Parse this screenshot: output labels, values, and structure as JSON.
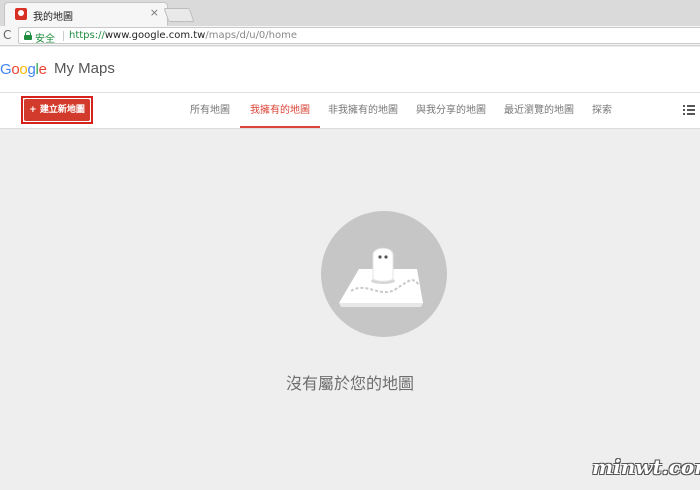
{
  "browser": {
    "tab_title": "我的地圖",
    "tab_close": "×",
    "reload_glyph": "C",
    "secure_label": "安全",
    "url_scheme": "https://",
    "url_host": "www.google.com.tw",
    "url_path": "/maps/d/u/0/home"
  },
  "header": {
    "logo_letters": [
      "G",
      "o",
      "o",
      "g",
      "l",
      "e"
    ],
    "logo_colors": [
      "#4285f4",
      "#ea4335",
      "#fbbc05",
      "#4285f4",
      "#34a853",
      "#ea4335"
    ],
    "product_name": "My Maps"
  },
  "toolbar": {
    "create_label": "+ 建立新地圖",
    "tabs": [
      {
        "label": "所有地圖",
        "active": false
      },
      {
        "label": "我擁有的地圖",
        "active": true
      },
      {
        "label": "非我擁有的地圖",
        "active": false
      },
      {
        "label": "與我分享的地圖",
        "active": false
      },
      {
        "label": "最近瀏覽的地圖",
        "active": false
      },
      {
        "label": "探索",
        "active": false
      }
    ],
    "menu_icon": "list-view-icon"
  },
  "empty_state": {
    "illustration": "ghost-on-map-icon",
    "message": "沒有屬於您的地圖"
  },
  "watermark": "minwt.com",
  "colors": {
    "accent": "#db4437",
    "create_button": "#d23b2c",
    "highlight_box": "#d6221d",
    "secure_green": "#1e8e3e",
    "page_bg": "#eeeeee"
  }
}
